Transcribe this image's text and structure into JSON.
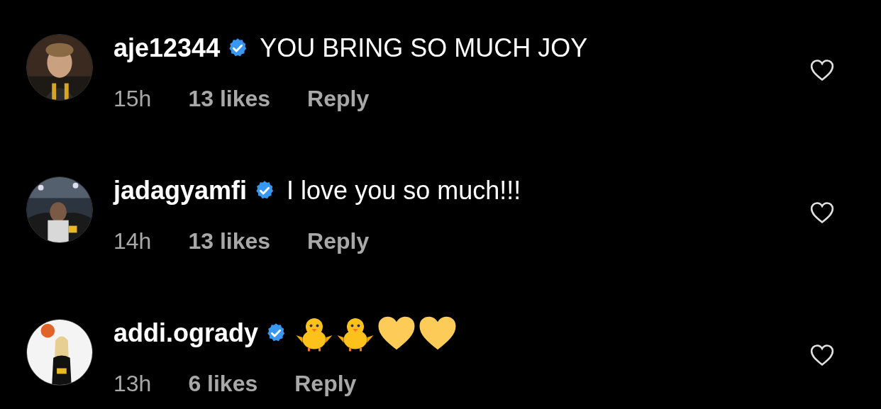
{
  "comments": [
    {
      "username": "aje12344",
      "verified": true,
      "text": "YOU BRING SO MUCH JOY",
      "time": "15h",
      "likes": "13 likes",
      "reply": "Reply",
      "liked": false
    },
    {
      "username": "jadagyamfi",
      "verified": true,
      "text": "I love you so much!!!",
      "time": "14h",
      "likes": "13 likes",
      "reply": "Reply",
      "liked": false
    },
    {
      "username": "addi.ogrady",
      "verified": true,
      "emoji": [
        {
          "kind": "chick"
        },
        {
          "kind": "chick"
        },
        {
          "kind": "heart"
        },
        {
          "kind": "heart"
        }
      ],
      "time": "13h",
      "likes": "6 likes",
      "reply": "Reply",
      "liked": false
    }
  ]
}
